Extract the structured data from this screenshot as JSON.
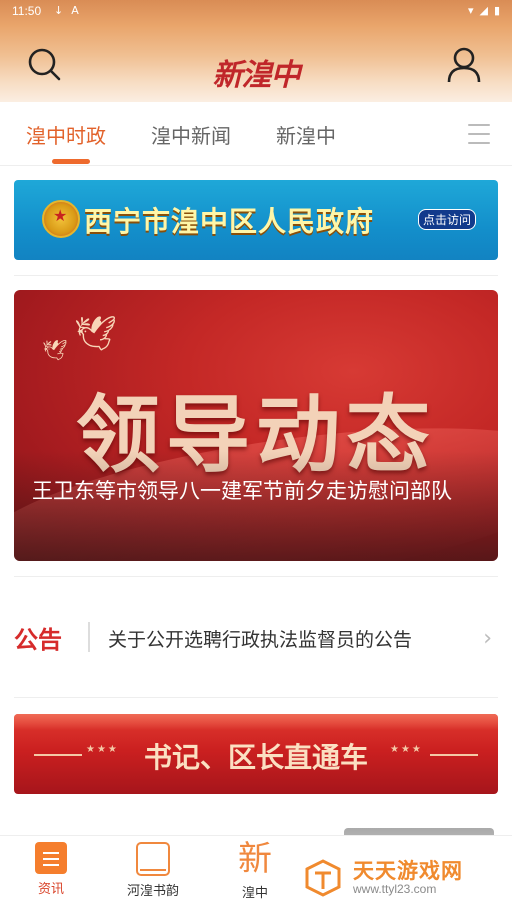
{
  "status_bar": {
    "time": "11:50",
    "left_icons": [
      "↓",
      "A"
    ],
    "right_icons": [
      "▾",
      "◢",
      "▮"
    ]
  },
  "header": {
    "logo_text": "新湟中"
  },
  "tabs": [
    {
      "label": "湟中时政",
      "active": true
    },
    {
      "label": "湟中新闻",
      "active": false
    },
    {
      "label": "新湟中",
      "active": false
    }
  ],
  "gov_banner": {
    "title": "西宁市湟中区人民政府",
    "button": "点击访问"
  },
  "lead_card": {
    "headline_art": "领导动态",
    "caption": "王卫东等市领导八一建军节前夕走访慰问部队"
  },
  "notice": {
    "label": "公告",
    "text": "关于公开选聘行政执法监督员的公告"
  },
  "direct_banner": {
    "title": "书记、区长直通车",
    "stars": "★★★"
  },
  "bottom_nav": [
    {
      "label": "资讯",
      "icon": "news-icon",
      "active": true
    },
    {
      "label": "河湟书韵",
      "icon": "book-icon",
      "active": false
    },
    {
      "label": "湟中",
      "icon": "xin-icon",
      "active": false
    }
  ],
  "watermark": {
    "main": "天天游戏网",
    "url": "www.ttyl23.com"
  },
  "colors": {
    "accent": "#e2622b",
    "notice_red": "#d62b2b",
    "banner_blue": "#138fcb",
    "card_red": "#c42826"
  }
}
